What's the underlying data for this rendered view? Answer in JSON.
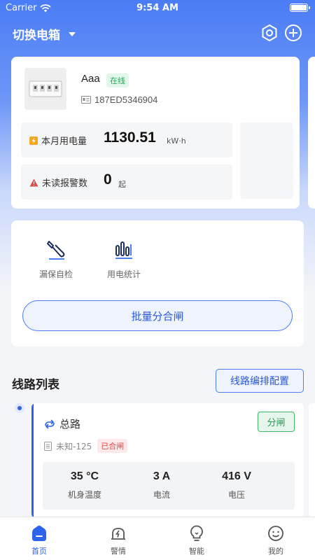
{
  "status_bar": {
    "carrier": "Carrier",
    "time": "9:54 AM"
  },
  "nav": {
    "title": "切换电箱"
  },
  "device": {
    "name": "Aaa",
    "status": "在线",
    "id": "187ED5346904",
    "monthly_energy_label": "本月用电量",
    "monthly_energy_value": "1130.51",
    "monthly_energy_unit": "kW·h",
    "alarm_label": "未读报警数",
    "alarm_value": "0",
    "alarm_unit": "起"
  },
  "functions": {
    "items": [
      {
        "label": "漏保自检",
        "icon": "leak-test-icon"
      },
      {
        "label": "用电统计",
        "icon": "stats-icon"
      }
    ],
    "batch_button": "批量分合闸"
  },
  "line_list": {
    "title": "线路列表",
    "arrange_button": "线路编排配置",
    "lines": [
      {
        "name": "总路",
        "model": "未知-125",
        "state": "已合闸",
        "action": "分闸",
        "metrics": [
          {
            "value": "35 °C",
            "label": "机身温度"
          },
          {
            "value": "3 A",
            "label": "电流"
          },
          {
            "value": "416 V",
            "label": "电压"
          }
        ]
      }
    ]
  },
  "tabs": [
    {
      "label": "首页",
      "icon": "home-icon",
      "active": true
    },
    {
      "label": "警情",
      "icon": "alert-icon",
      "active": false
    },
    {
      "label": "智能",
      "icon": "bulb-icon",
      "active": false
    },
    {
      "label": "我的",
      "icon": "profile-icon",
      "active": false
    }
  ],
  "colors": {
    "primary": "#2d63ea",
    "online_green": "#1fae58",
    "alarm_red": "#e24a4a"
  }
}
